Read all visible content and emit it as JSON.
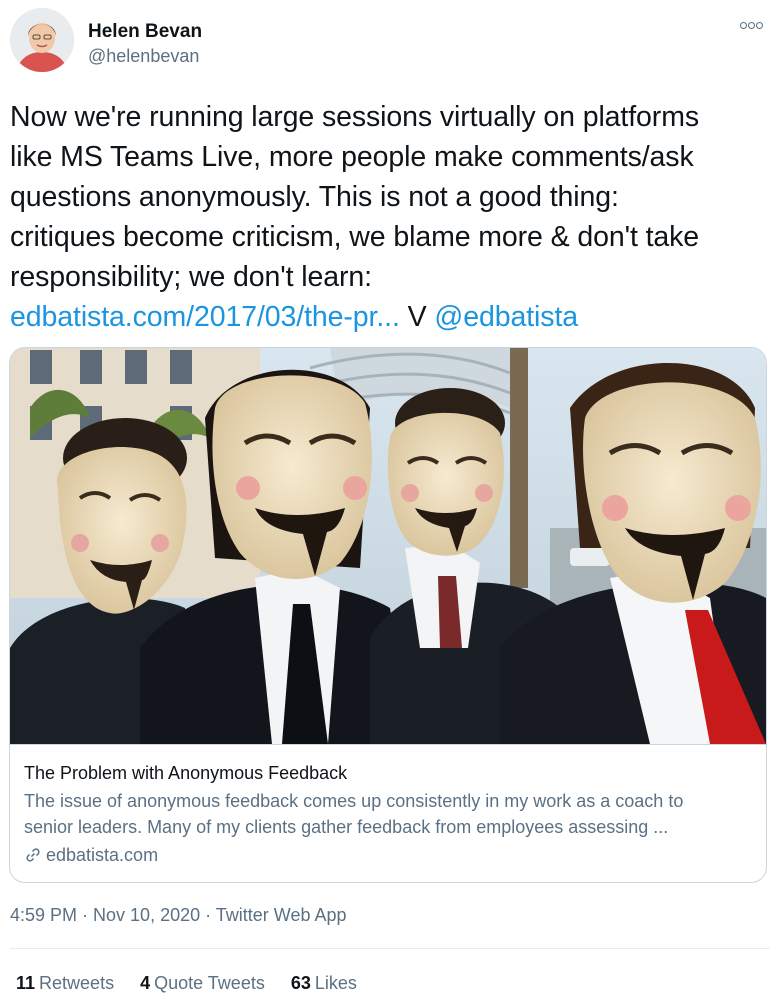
{
  "author": {
    "name": "Helen Bevan",
    "handle": "@helenbevan"
  },
  "tweet": {
    "text_lines": [
      "Now we're running large sessions virtually on platforms",
      "like MS Teams Live, more people make comments/ask",
      "questions anonymously. This is not a good thing:",
      "critiques become criticism, we blame more & don't take",
      "responsibility; we don't learn:"
    ],
    "link": "edbatista.com/2017/03/the-pr...",
    "via": "V",
    "mention": "@edbatista"
  },
  "card": {
    "title": "The Problem with Anonymous Feedback",
    "description_lines": [
      "The issue of anonymous feedback comes up consistently in my work as a coach to",
      "senior leaders. Many of my clients gather feedback from employees assessing ..."
    ],
    "domain": "edbatista.com"
  },
  "meta": {
    "timestamp": "4:59 PM · Nov 10, 2020 · Twitter Web App"
  },
  "stats": {
    "retweets_count": "11",
    "retweets_label": "Retweets",
    "quotes_count": "4",
    "quotes_label": "Quote Tweets",
    "likes_count": "63",
    "likes_label": "Likes"
  },
  "icons": {
    "more": "more-dots-icon",
    "link": "link-chain-icon"
  },
  "colors": {
    "link": "#1b95e0",
    "secondary_text": "#5b7083",
    "primary_text": "#0f1419"
  }
}
